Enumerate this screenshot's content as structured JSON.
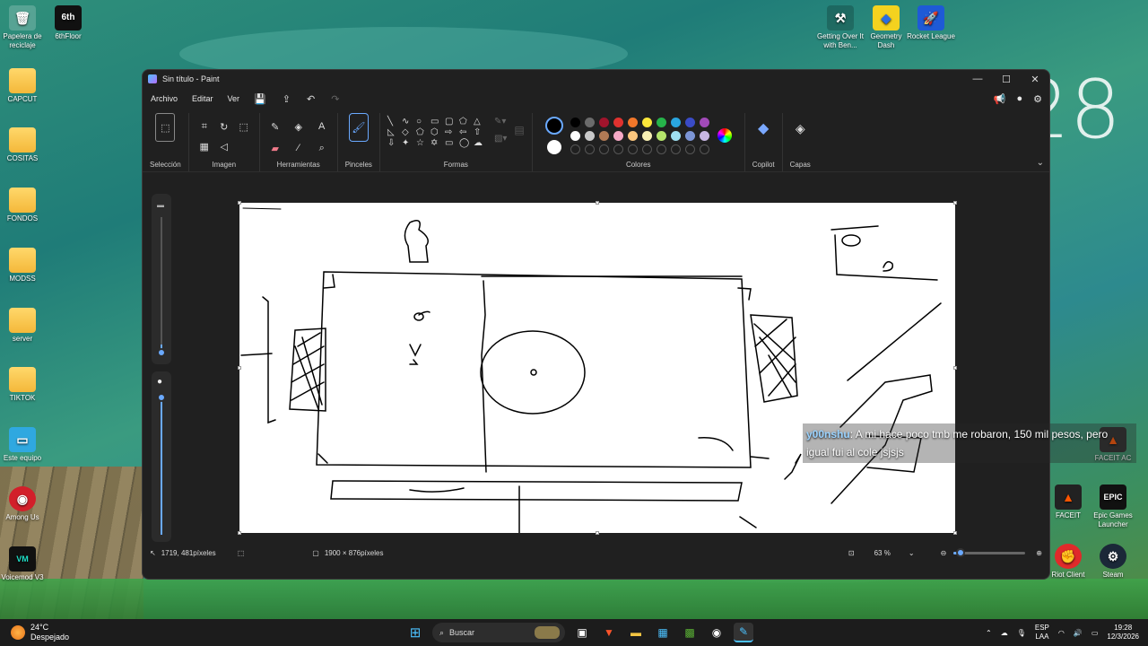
{
  "desktop": {
    "clock_overlay": "28",
    "icons_left": [
      {
        "label": "Papelera de reciclaje",
        "icon": "recycle-bin-icon",
        "glyph": "🗑"
      },
      {
        "label": "Este equipo",
        "icon": "monitor-icon",
        "glyph": "▭"
      },
      {
        "label": "Among Us",
        "icon": "among-us-icon",
        "glyph": "◉"
      },
      {
        "label": "Voicemod V3",
        "icon": "voicemod-icon",
        "glyph": "VM"
      }
    ],
    "folders": [
      "CAPCUT",
      "COSITAS",
      "FONDOS",
      "MODSS",
      "server",
      "TIKTOK"
    ],
    "icon_6th": {
      "label": "6thFloor",
      "glyph": "6th"
    },
    "icons_top_right": [
      {
        "label": "Getting Over It with Ben...",
        "icon": "hammer-icon",
        "glyph": "⚒"
      },
      {
        "label": "Geometry Dash",
        "icon": "geometry-dash-icon",
        "glyph": "◆"
      },
      {
        "label": "Rocket League",
        "icon": "rocket-league-icon",
        "glyph": "🚀"
      }
    ],
    "icons_bottom_right": [
      {
        "label": "FACEIT AC",
        "icon": "faceit-icon",
        "glyph": "▲"
      },
      {
        "label": "FACEIT",
        "icon": "faceit-icon",
        "glyph": "▲"
      },
      {
        "label": "Epic Games Launcher",
        "icon": "epic-games-icon",
        "glyph": "EPIC"
      },
      {
        "label": "Riot Client",
        "icon": "riot-icon",
        "glyph": "✊"
      },
      {
        "label": "Steam",
        "icon": "steam-icon",
        "glyph": "⚙"
      }
    ]
  },
  "window": {
    "title": "Sin título - Paint",
    "menu": [
      "Archivo",
      "Editar",
      "Ver"
    ],
    "groups": {
      "seleccion": "Selección",
      "imagen": "Imagen",
      "herramientas": "Herramientas",
      "pinceles": "Pinceles",
      "formas": "Formas",
      "colores": "Colores",
      "copilot": "Copilot",
      "capas": "Capas"
    },
    "palette_row1": [
      "#000000",
      "#6b6b6b",
      "#a0142c",
      "#e0322f",
      "#f2772a",
      "#fce73a",
      "#26b34a",
      "#2aa6e0",
      "#3a4bc6",
      "#a24ab9"
    ],
    "palette_row2": [
      "#ffffff",
      "#c8c8c8",
      "#b07a55",
      "#f5a8c6",
      "#fcc77e",
      "#f8f0b3",
      "#b5e46b",
      "#9fe0f2",
      "#7c95d6",
      "#c8b7e3"
    ],
    "status": {
      "cursor": "1719, 481píxeles",
      "size": "1900 × 876píxeles",
      "zoom": "63 %",
      "zoom_fraction": 0.1
    }
  },
  "chat": {
    "user": "y00nshu",
    "message": ": A mi hace poco tmb me robaron, 150 mil pesos, pero igual fui al cole jsjsjs"
  },
  "taskbar": {
    "temp": "24°C",
    "weather": "Despejado",
    "search_placeholder": "Buscar",
    "lang_top": "ESP",
    "lang_bottom": "LAA",
    "time": "19:28",
    "date": "12/3/2026"
  }
}
